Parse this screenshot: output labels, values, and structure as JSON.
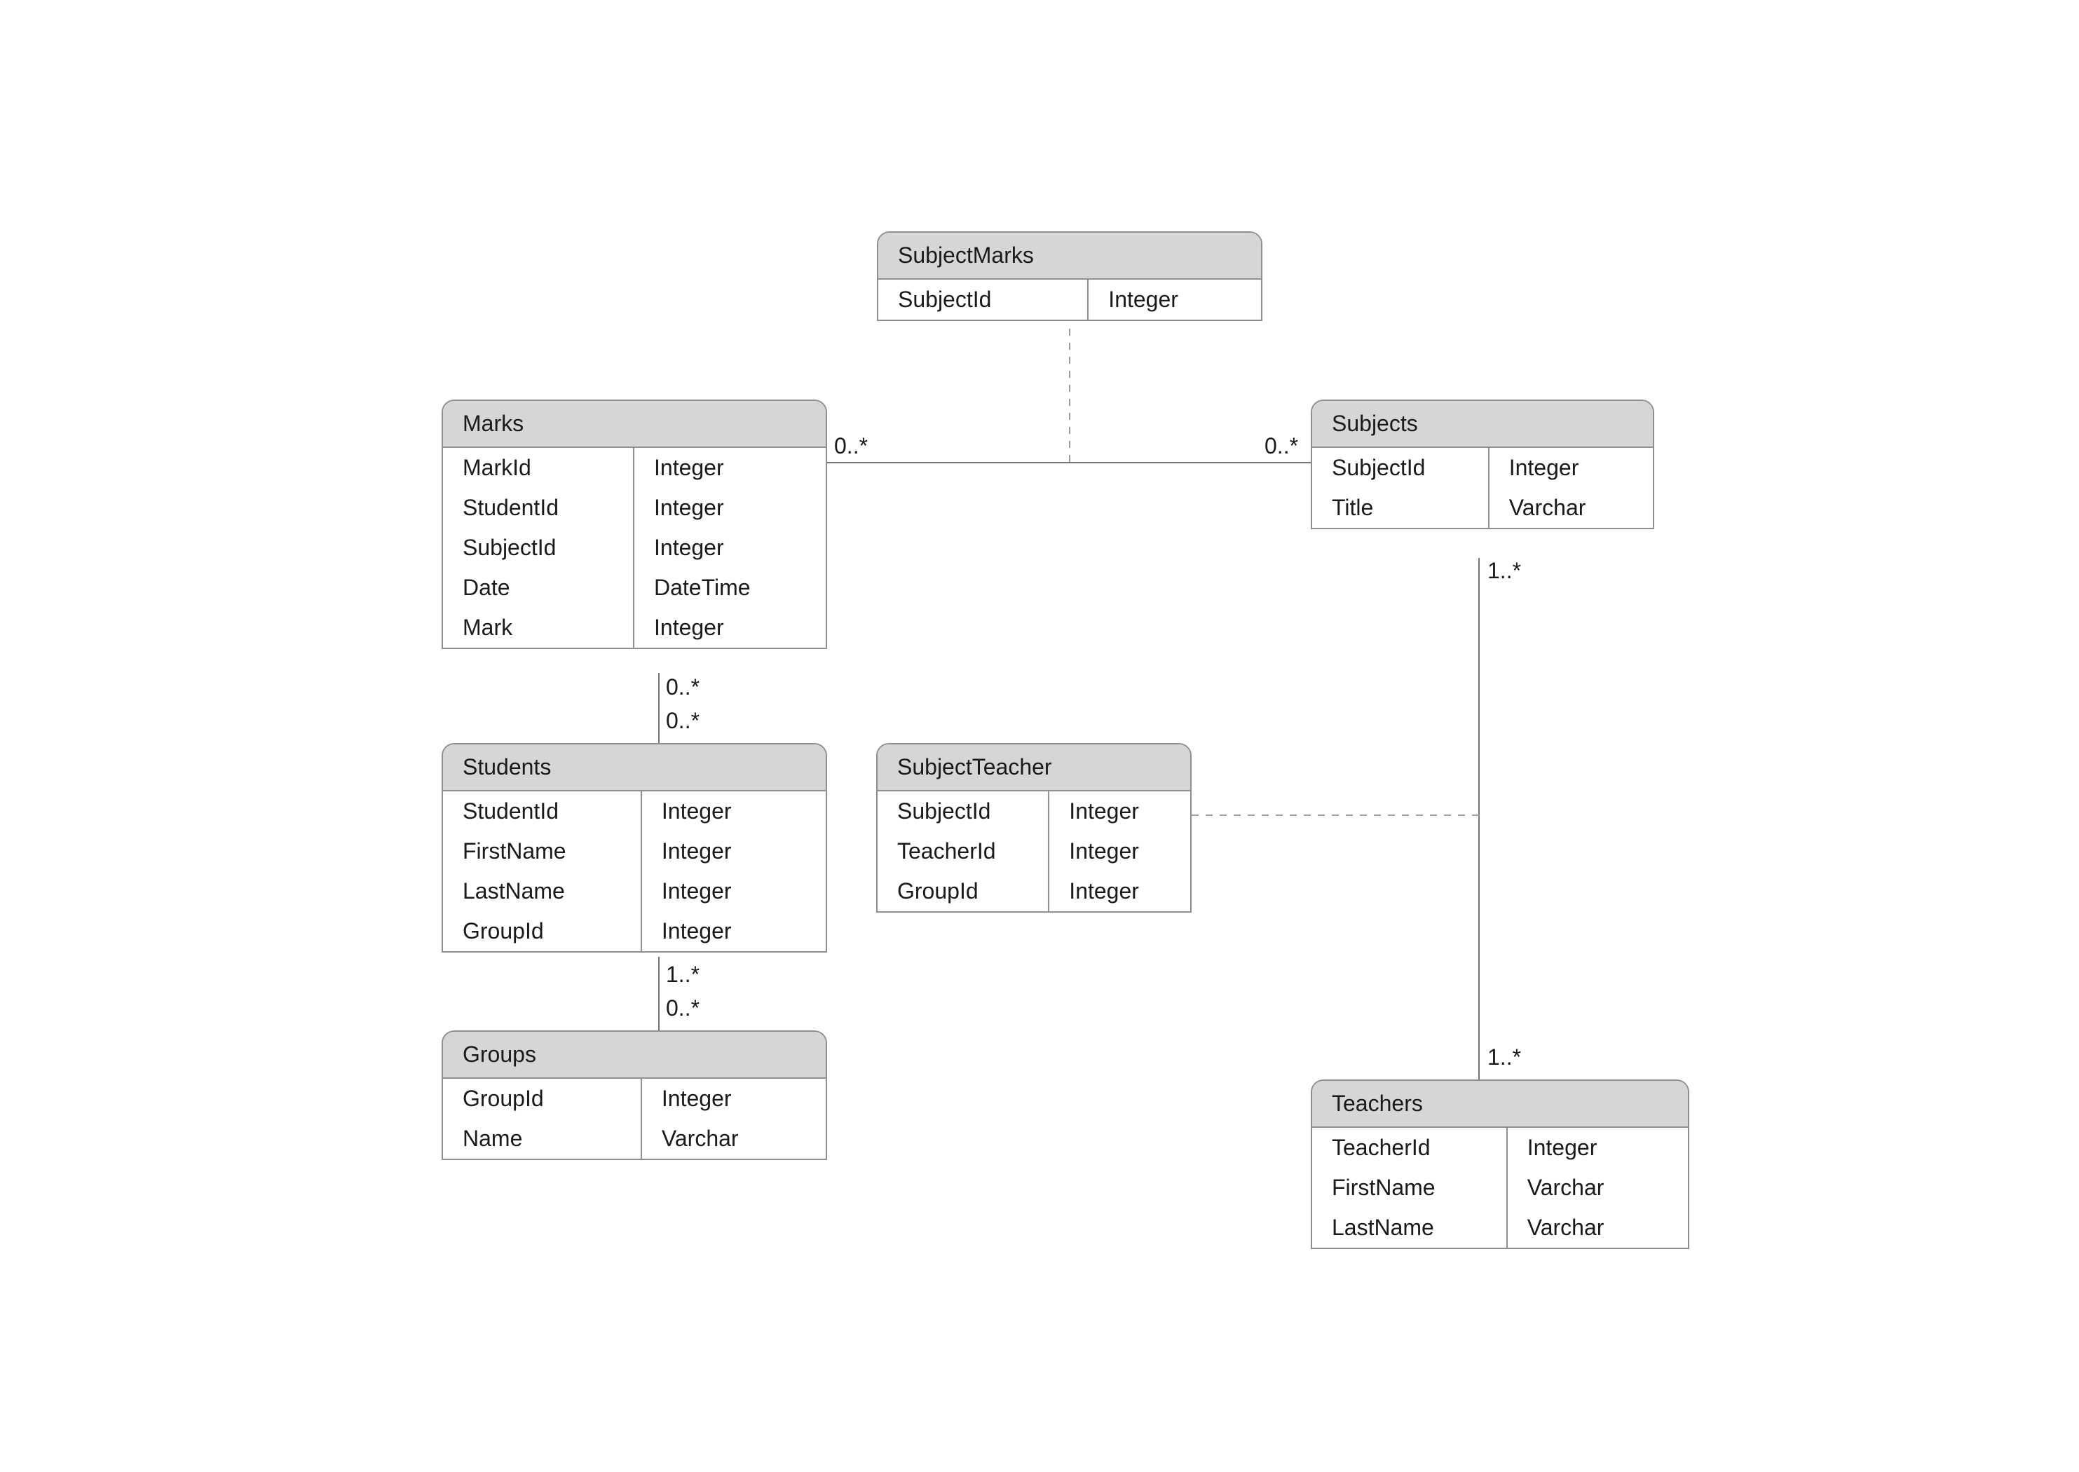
{
  "entities": {
    "subjectMarks": {
      "title": "SubjectMarks",
      "fields": [
        {
          "name": "SubjectId",
          "type": "Integer"
        }
      ]
    },
    "marks": {
      "title": "Marks",
      "fields": [
        {
          "name": "MarkId",
          "type": "Integer"
        },
        {
          "name": "StudentId",
          "type": "Integer"
        },
        {
          "name": "SubjectId",
          "type": "Integer"
        },
        {
          "name": "Date",
          "type": "DateTime"
        },
        {
          "name": "Mark",
          "type": "Integer"
        }
      ]
    },
    "subjects": {
      "title": "Subjects",
      "fields": [
        {
          "name": "SubjectId",
          "type": "Integer"
        },
        {
          "name": "Title",
          "type": "Varchar"
        }
      ]
    },
    "students": {
      "title": "Students",
      "fields": [
        {
          "name": "StudentId",
          "type": "Integer"
        },
        {
          "name": "FirstName",
          "type": "Integer"
        },
        {
          "name": "LastName",
          "type": "Integer"
        },
        {
          "name": "GroupId",
          "type": "Integer"
        }
      ]
    },
    "subjectTeacher": {
      "title": "SubjectTeacher",
      "fields": [
        {
          "name": "SubjectId",
          "type": "Integer"
        },
        {
          "name": "TeacherId",
          "type": "Integer"
        },
        {
          "name": "GroupId",
          "type": "Integer"
        }
      ]
    },
    "groups": {
      "title": "Groups",
      "fields": [
        {
          "name": "GroupId",
          "type": "Integer"
        },
        {
          "name": "Name",
          "type": "Varchar"
        }
      ]
    },
    "teachers": {
      "title": "Teachers",
      "fields": [
        {
          "name": "TeacherId",
          "type": "Integer"
        },
        {
          "name": "FirstName",
          "type": "Varchar"
        },
        {
          "name": "LastName",
          "type": "Varchar"
        }
      ]
    }
  },
  "multiplicities": {
    "marksSubjectsLeft": "0..*",
    "marksSubjectsRight": "0..*",
    "marksBottom": "0..*",
    "studentsTop": "0..*",
    "subjectsBottom": "1..*",
    "studentsBottom": "1..*",
    "groupsTop": "0..*",
    "teachersTop": "1..*"
  }
}
